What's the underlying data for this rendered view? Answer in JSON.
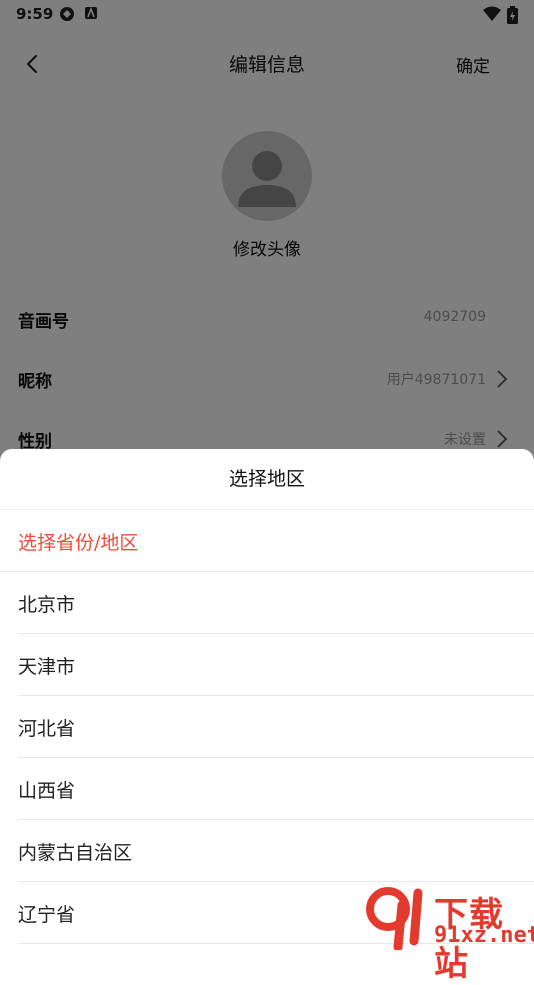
{
  "status_bar": {
    "time": "9:59"
  },
  "header": {
    "title": "编辑信息",
    "confirm_label": "确定"
  },
  "avatar": {
    "label": "修改头像"
  },
  "info_rows": [
    {
      "label": "音画号",
      "value": "4092709",
      "has_arrow": false
    },
    {
      "label": "昵称",
      "value": "用户49871071",
      "has_arrow": true
    },
    {
      "label": "性别",
      "value": "未设置",
      "has_arrow": true
    }
  ],
  "region_sheet": {
    "title": "选择地区",
    "selected_prompt": "选择省份/地区",
    "regions": [
      "北京市",
      "天津市",
      "河北省",
      "山西省",
      "内蒙古自治区",
      "辽宁省"
    ]
  },
  "watermark": {
    "text": "下载站",
    "url": "91xz.net"
  },
  "colors": {
    "accent": "#ec4d3b",
    "overlay": "rgba(0,0,0,0.5)",
    "watermark": "#e23b2e"
  },
  "icons": [
    "back-arrow-icon",
    "chevron-right-icon",
    "default-avatar-icon",
    "wifi-icon",
    "battery-icon",
    "sync-icon",
    "app-notification-icon"
  ]
}
